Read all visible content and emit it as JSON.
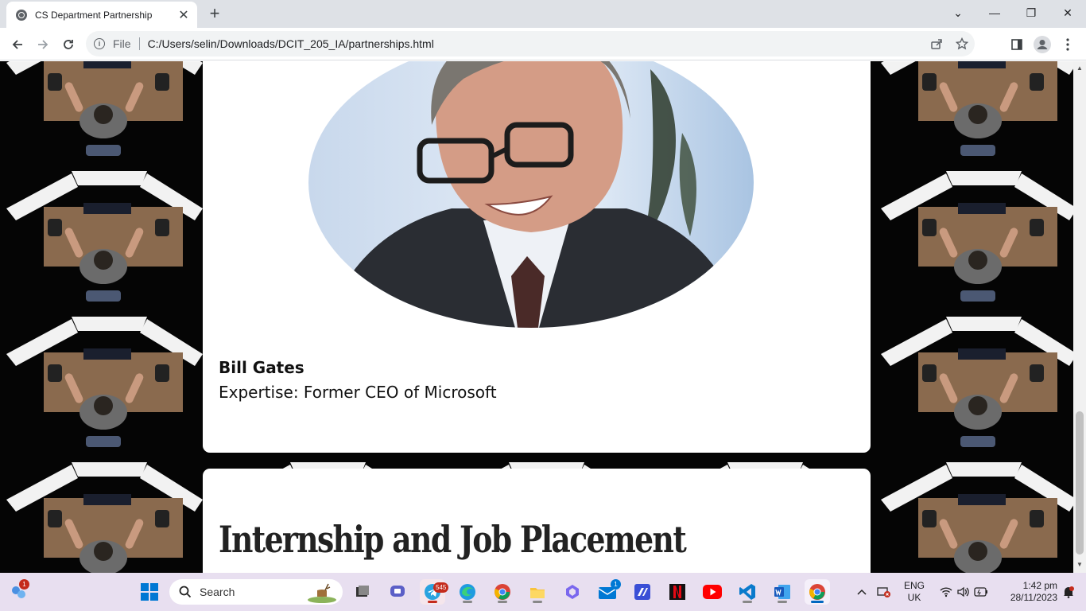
{
  "browser": {
    "tab_title": "CS Department Partnership",
    "tab_close": "✕",
    "new_tab": "+",
    "url_scheme": "File",
    "url": "C:/Users/selin/Downloads/DCIT_205_IA/partnerships.html",
    "window_controls": [
      "⌄",
      "—",
      "❐",
      "✕"
    ]
  },
  "page": {
    "partner": {
      "name": "Bill Gates",
      "expertise": "Expertise: Former CEO of Microsoft"
    },
    "next_section_heading": "Internship and Job Placement"
  },
  "taskbar": {
    "search_label": "Search",
    "notifications_badge": "1",
    "telegram_badge": "545",
    "mail_badge": "1",
    "language": "ENG",
    "region": "UK",
    "time": "1:42 pm",
    "date": "28/11/2023"
  },
  "colors": {
    "taskbar": "#e8dff0",
    "tabstrip": "#dee1e6",
    "page_bg": "#000000",
    "card": "#ffffff"
  }
}
